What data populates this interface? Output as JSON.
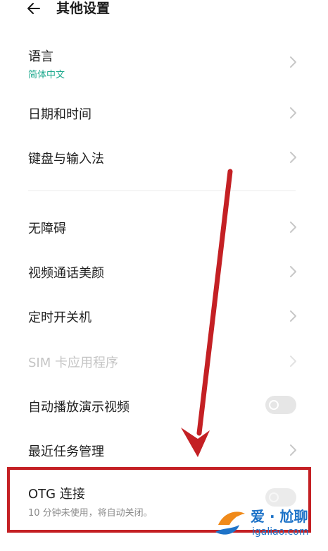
{
  "header": {
    "title": "其他设置"
  },
  "items": {
    "language": {
      "label": "语言",
      "value": "简体中文"
    },
    "datetime": {
      "label": "日期和时间"
    },
    "keyboard": {
      "label": "键盘与输入法"
    },
    "accessibility": {
      "label": "无障碍"
    },
    "video_beauty": {
      "label": "视频通话美颜"
    },
    "scheduled_power": {
      "label": "定时开关机"
    },
    "sim_apps": {
      "label": "SIM 卡应用程序"
    },
    "autoplay_demo": {
      "label": "自动播放演示视频"
    },
    "recent_tasks": {
      "label": "最近任务管理"
    },
    "otg": {
      "label": "OTG 连接",
      "description": "10 分钟未使用，将自动关闭。"
    }
  },
  "watermark": {
    "text_main": "爱 · 尬聊",
    "text_url": "igaliao.com"
  },
  "colors": {
    "accent": "#1aa88c",
    "highlight": "#c42024",
    "disabled_text": "#c4c4c4"
  }
}
